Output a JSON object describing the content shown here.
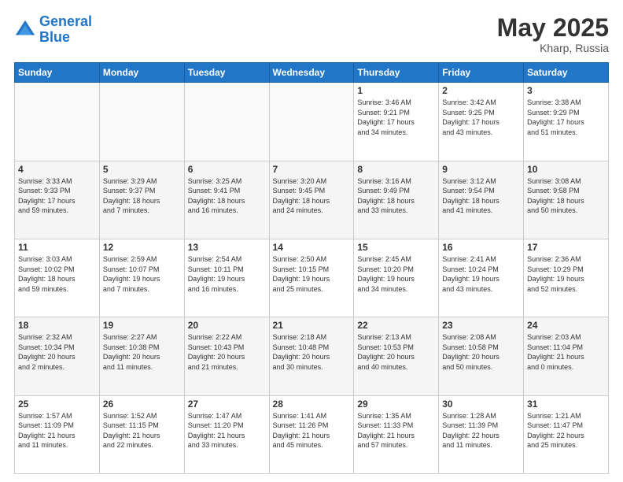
{
  "header": {
    "logo_line1": "General",
    "logo_line2": "Blue",
    "title": "May 2025",
    "subtitle": "Kharp, Russia"
  },
  "days_of_week": [
    "Sunday",
    "Monday",
    "Tuesday",
    "Wednesday",
    "Thursday",
    "Friday",
    "Saturday"
  ],
  "weeks": [
    [
      {
        "num": "",
        "info": ""
      },
      {
        "num": "",
        "info": ""
      },
      {
        "num": "",
        "info": ""
      },
      {
        "num": "",
        "info": ""
      },
      {
        "num": "1",
        "info": "Sunrise: 3:46 AM\nSunset: 9:21 PM\nDaylight: 17 hours\nand 34 minutes."
      },
      {
        "num": "2",
        "info": "Sunrise: 3:42 AM\nSunset: 9:25 PM\nDaylight: 17 hours\nand 43 minutes."
      },
      {
        "num": "3",
        "info": "Sunrise: 3:38 AM\nSunset: 9:29 PM\nDaylight: 17 hours\nand 51 minutes."
      }
    ],
    [
      {
        "num": "4",
        "info": "Sunrise: 3:33 AM\nSunset: 9:33 PM\nDaylight: 17 hours\nand 59 minutes."
      },
      {
        "num": "5",
        "info": "Sunrise: 3:29 AM\nSunset: 9:37 PM\nDaylight: 18 hours\nand 7 minutes."
      },
      {
        "num": "6",
        "info": "Sunrise: 3:25 AM\nSunset: 9:41 PM\nDaylight: 18 hours\nand 16 minutes."
      },
      {
        "num": "7",
        "info": "Sunrise: 3:20 AM\nSunset: 9:45 PM\nDaylight: 18 hours\nand 24 minutes."
      },
      {
        "num": "8",
        "info": "Sunrise: 3:16 AM\nSunset: 9:49 PM\nDaylight: 18 hours\nand 33 minutes."
      },
      {
        "num": "9",
        "info": "Sunrise: 3:12 AM\nSunset: 9:54 PM\nDaylight: 18 hours\nand 41 minutes."
      },
      {
        "num": "10",
        "info": "Sunrise: 3:08 AM\nSunset: 9:58 PM\nDaylight: 18 hours\nand 50 minutes."
      }
    ],
    [
      {
        "num": "11",
        "info": "Sunrise: 3:03 AM\nSunset: 10:02 PM\nDaylight: 18 hours\nand 59 minutes."
      },
      {
        "num": "12",
        "info": "Sunrise: 2:59 AM\nSunset: 10:07 PM\nDaylight: 19 hours\nand 7 minutes."
      },
      {
        "num": "13",
        "info": "Sunrise: 2:54 AM\nSunset: 10:11 PM\nDaylight: 19 hours\nand 16 minutes."
      },
      {
        "num": "14",
        "info": "Sunrise: 2:50 AM\nSunset: 10:15 PM\nDaylight: 19 hours\nand 25 minutes."
      },
      {
        "num": "15",
        "info": "Sunrise: 2:45 AM\nSunset: 10:20 PM\nDaylight: 19 hours\nand 34 minutes."
      },
      {
        "num": "16",
        "info": "Sunrise: 2:41 AM\nSunset: 10:24 PM\nDaylight: 19 hours\nand 43 minutes."
      },
      {
        "num": "17",
        "info": "Sunrise: 2:36 AM\nSunset: 10:29 PM\nDaylight: 19 hours\nand 52 minutes."
      }
    ],
    [
      {
        "num": "18",
        "info": "Sunrise: 2:32 AM\nSunset: 10:34 PM\nDaylight: 20 hours\nand 2 minutes."
      },
      {
        "num": "19",
        "info": "Sunrise: 2:27 AM\nSunset: 10:38 PM\nDaylight: 20 hours\nand 11 minutes."
      },
      {
        "num": "20",
        "info": "Sunrise: 2:22 AM\nSunset: 10:43 PM\nDaylight: 20 hours\nand 21 minutes."
      },
      {
        "num": "21",
        "info": "Sunrise: 2:18 AM\nSunset: 10:48 PM\nDaylight: 20 hours\nand 30 minutes."
      },
      {
        "num": "22",
        "info": "Sunrise: 2:13 AM\nSunset: 10:53 PM\nDaylight: 20 hours\nand 40 minutes."
      },
      {
        "num": "23",
        "info": "Sunrise: 2:08 AM\nSunset: 10:58 PM\nDaylight: 20 hours\nand 50 minutes."
      },
      {
        "num": "24",
        "info": "Sunrise: 2:03 AM\nSunset: 11:04 PM\nDaylight: 21 hours\nand 0 minutes."
      }
    ],
    [
      {
        "num": "25",
        "info": "Sunrise: 1:57 AM\nSunset: 11:09 PM\nDaylight: 21 hours\nand 11 minutes."
      },
      {
        "num": "26",
        "info": "Sunrise: 1:52 AM\nSunset: 11:15 PM\nDaylight: 21 hours\nand 22 minutes."
      },
      {
        "num": "27",
        "info": "Sunrise: 1:47 AM\nSunset: 11:20 PM\nDaylight: 21 hours\nand 33 minutes."
      },
      {
        "num": "28",
        "info": "Sunrise: 1:41 AM\nSunset: 11:26 PM\nDaylight: 21 hours\nand 45 minutes."
      },
      {
        "num": "29",
        "info": "Sunrise: 1:35 AM\nSunset: 11:33 PM\nDaylight: 21 hours\nand 57 minutes."
      },
      {
        "num": "30",
        "info": "Sunrise: 1:28 AM\nSunset: 11:39 PM\nDaylight: 22 hours\nand 11 minutes."
      },
      {
        "num": "31",
        "info": "Sunrise: 1:21 AM\nSunset: 11:47 PM\nDaylight: 22 hours\nand 25 minutes."
      }
    ]
  ]
}
